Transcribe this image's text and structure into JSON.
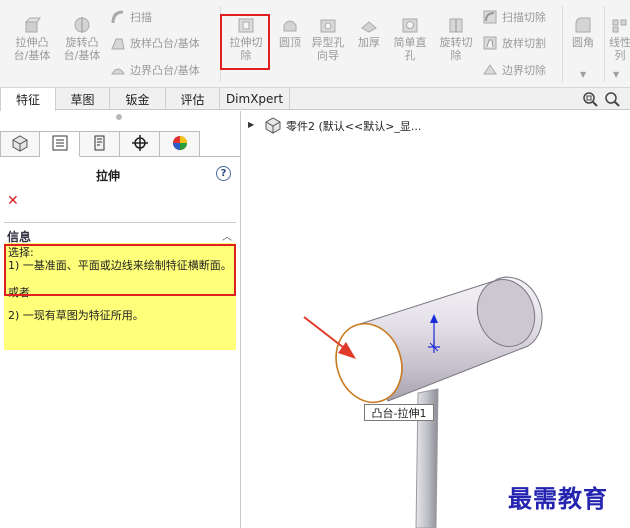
{
  "ribbon": {
    "groups": {
      "extrude_boss": "拉伸凸\n台/基体",
      "revolve_boss": "旋转凸\n台/基体",
      "sweep": "扫描",
      "loft_boss": "放样凸台/基体",
      "boundary_boss": "边界凸台/基体",
      "extrude_cut": "拉伸切\n除",
      "dome": "圆顶",
      "hole_wizard": "异型孔\n向导",
      "thicken": "加厚",
      "simple_hole": "简单直\n孔",
      "revolve_cut": "旋转切\n除",
      "sweep_cut": "扫描切除",
      "loft_cut": "放样切割",
      "boundary_cut": "边界切除",
      "fillet": "圆角",
      "linear_pattern": "线性\n列"
    }
  },
  "tabs": [
    "特征",
    "草图",
    "钣金",
    "评估",
    "DimXpert"
  ],
  "panel": {
    "title": "拉伸",
    "help": "?",
    "cancel": "✕",
    "section_title": "信息",
    "collapse": "︿",
    "info_line1": "选择:",
    "info_line2": "1) 一基准面、平面或边线来绘制特征横断面。",
    "info_or": "或者",
    "info_line3": "2) 一现有草图为特征所用。"
  },
  "view": {
    "tree_label": "零件2  (默认<<默认>_显...",
    "callout": "凸台-拉伸1"
  },
  "watermark": "最需教育",
  "colors": {
    "highlight_red": "#e02020",
    "info_yellow": "#ffff7a",
    "watermark_blue": "#2424b0",
    "edge_orange": "#c8781e"
  }
}
